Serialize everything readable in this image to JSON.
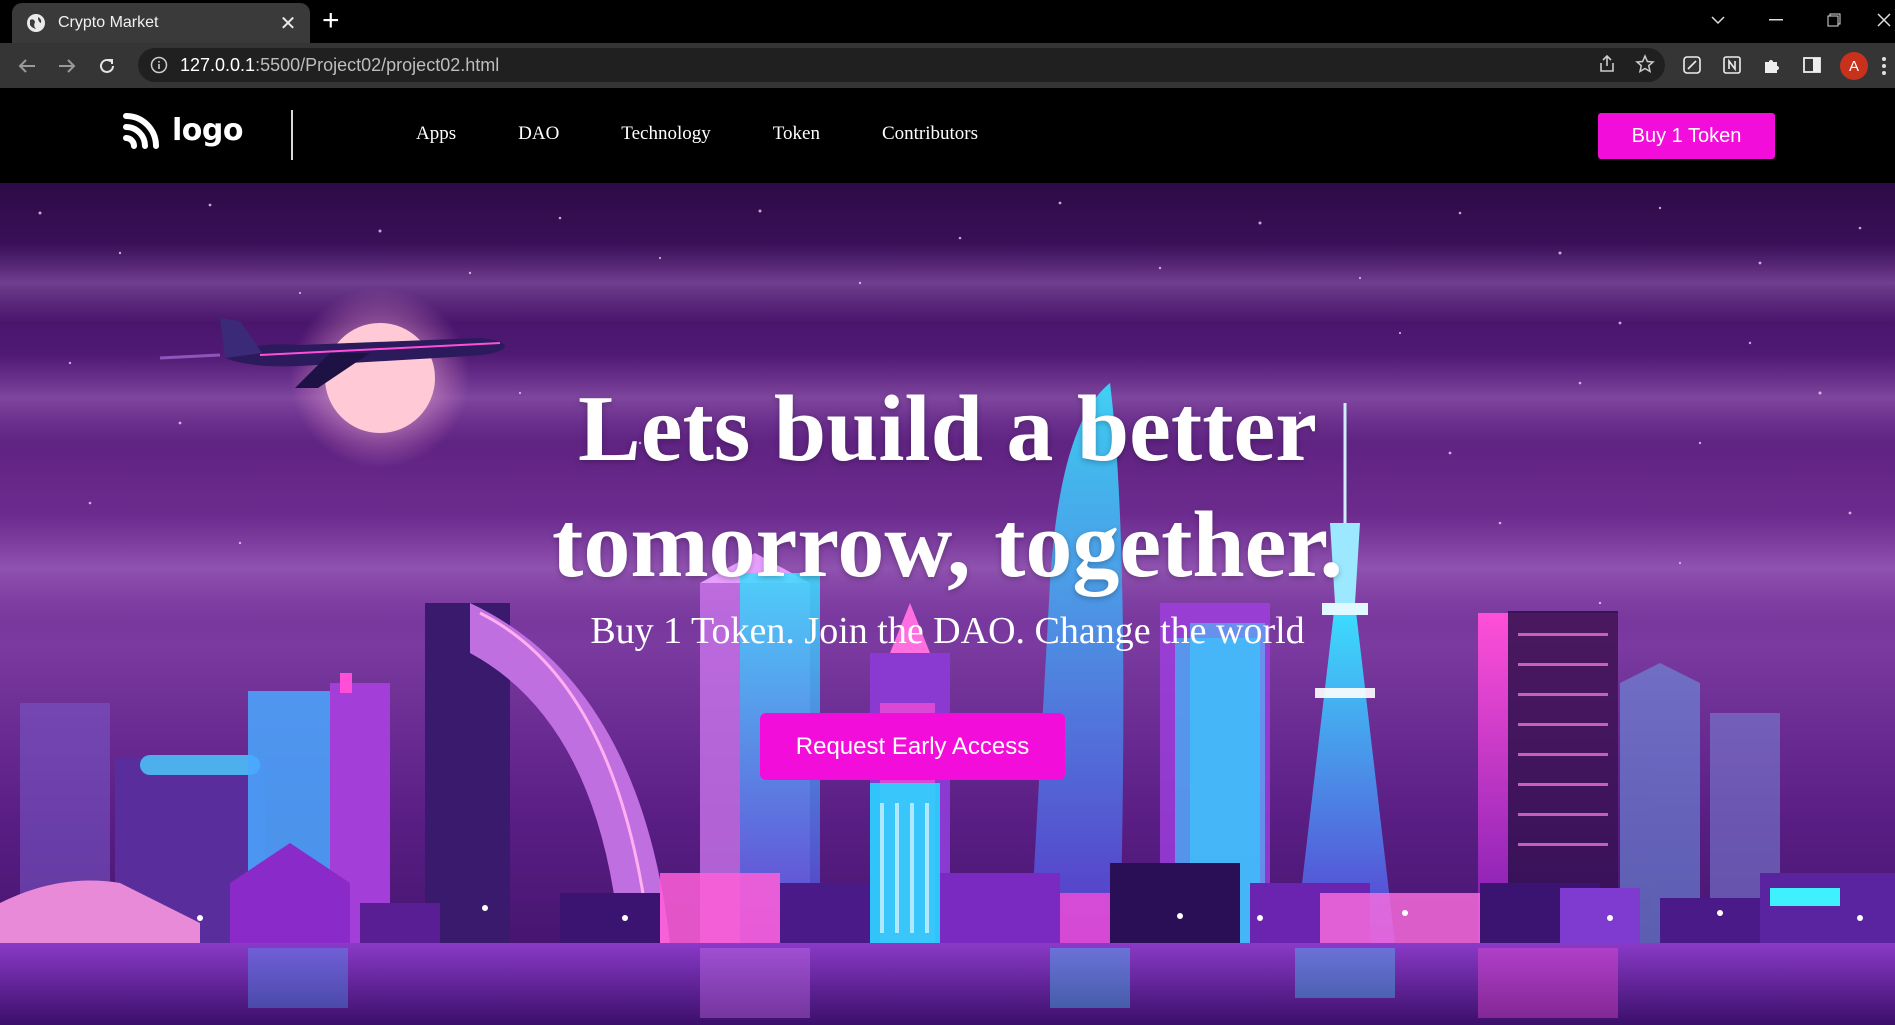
{
  "browser": {
    "tab_title": "Crypto Market",
    "url_host": "127.0.0.1",
    "url_rest": ":5500/Project02/project02.html",
    "profile_initial": "A"
  },
  "site": {
    "logo_text": "logo",
    "nav_links": [
      "Apps",
      "DAO",
      "Technology",
      "Token",
      "Contributors"
    ],
    "buy_button": "Buy 1 Token"
  },
  "hero": {
    "headline_line1": "Lets build a better",
    "headline_line2": "tomorrow, together.",
    "subheadline": "Buy 1 Token. Join the DAO. Change the world",
    "cta_label": "Request Early Access"
  },
  "colors": {
    "accent": "#f30ddb",
    "nav_bg": "#000000",
    "chrome_toolbar": "#353535"
  }
}
